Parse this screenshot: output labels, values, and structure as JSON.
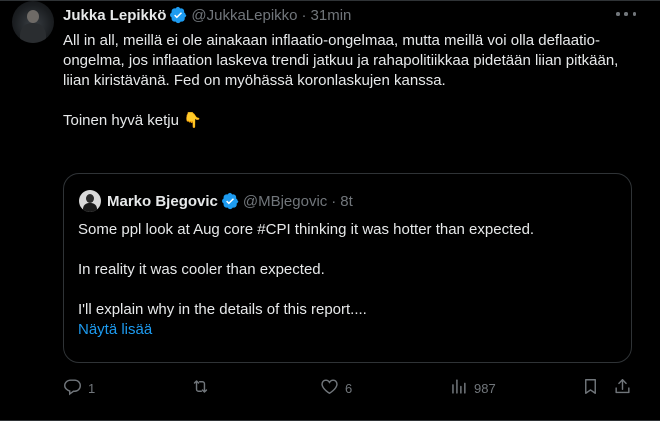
{
  "author": {
    "name": "Jukka Lepikkö",
    "handle": "@JukkaLepikko",
    "separator": "·",
    "time": "31min"
  },
  "tweet": {
    "paragraph1": "All in all, meillä ei ole ainakaan inflaatio-ongelmaa, mutta meillä voi olla deflaatio-ongelma, jos inflaation laskeva trendi jatkuu ja rahapolitiikkaa pidetään liian pitkään, liian kiristävänä. Fed on myöhässä koronlaskujen kanssa.",
    "paragraph2": "Toinen hyvä ketju 👇"
  },
  "quoted": {
    "name": "Marko Bjegovic",
    "handle": "@MBjegovic",
    "separator": "·",
    "time": "8t",
    "line1": "Some ppl look at Aug core #CPI thinking it was hotter than expected.",
    "line2": "In reality it was cooler than expected.",
    "line3": "I'll explain why in the details of this report....",
    "show_more": "Näytä lisää"
  },
  "actions": {
    "reply_count": "1",
    "retweet_count": "",
    "like_count": "6",
    "views_count": "987"
  },
  "icons": {
    "verified": "verified-badge-icon",
    "reply": "reply-icon",
    "retweet": "retweet-icon",
    "like": "heart-icon",
    "views": "views-chart-icon",
    "share": "share-icon",
    "more": "more-icon"
  },
  "colors": {
    "background": "#000000",
    "text": "#e7e9ea",
    "muted": "#71767b",
    "accent": "#1d9bf0",
    "border": "#2f3336"
  }
}
